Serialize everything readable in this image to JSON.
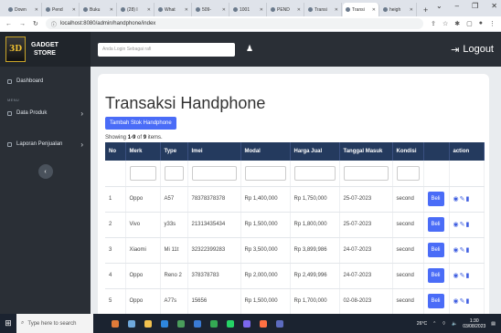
{
  "browser": {
    "tabs": [
      {
        "label": "Down",
        "active": false
      },
      {
        "label": "Pend",
        "active": false
      },
      {
        "label": "Buku",
        "active": false
      },
      {
        "label": "(28) I",
        "active": false
      },
      {
        "label": "What",
        "active": false
      },
      {
        "label": "509-",
        "active": false
      },
      {
        "label": "1001",
        "active": false
      },
      {
        "label": "PEND",
        "active": false
      },
      {
        "label": "Transi",
        "active": false
      },
      {
        "label": "Transi",
        "active": true
      },
      {
        "label": "heigh",
        "active": false
      }
    ],
    "new_tab": "+",
    "url": "localhost:8080/admin/handphone/index"
  },
  "sidebar": {
    "brand_line1": "GADGET",
    "brand_line2": "STORE",
    "logo_text": "3D",
    "items": [
      {
        "label": "Dashboard"
      },
      {
        "label": "Data Produk"
      },
      {
        "label": "Laporan Penjualan"
      }
    ],
    "heading": "MENU"
  },
  "navbar": {
    "search_placeholder": "Anda Login Sebagai rafi",
    "logout_label": "Logout"
  },
  "page": {
    "title": "Transaksi Handphone",
    "add_button": "Tambah Stok Handphone",
    "summary_prefix": "Showing ",
    "summary_range": "1-9",
    "summary_of": " of ",
    "summary_total": "9",
    "summary_suffix": " items."
  },
  "table": {
    "headers": [
      "No",
      "Merk",
      "Type",
      "Imei",
      "Modal",
      "Harga Jual",
      "Tanggal Masuk",
      "Kondisi",
      "",
      "action"
    ],
    "rows": [
      [
        "1",
        "Oppo",
        "A57",
        "78378378378",
        "Rp 1,400,000",
        "Rp 1,750,000",
        "25-07-2023",
        "second"
      ],
      [
        "2",
        "Vivo",
        "y33s",
        "21313435434",
        "Rp 1,500,000",
        "Rp 1,800,000",
        "25-07-2023",
        "second"
      ],
      [
        "3",
        "Xiaomi",
        "Mi 11t",
        "32322399283",
        "Rp 3,500,000",
        "Rp 3,899,986",
        "24-07-2023",
        "second"
      ],
      [
        "4",
        "Oppo",
        "Reno 2",
        "378378783",
        "Rp 2,000,000",
        "Rp 2,499,996",
        "24-07-2023",
        "second"
      ],
      [
        "5",
        "Oppo",
        "A77s",
        "15656",
        "Rp 1,500,000",
        "Rp 1,700,000",
        "02-08-2023",
        "second"
      ]
    ],
    "beli_label": "Beli",
    "action_icons": [
      "eye-icon",
      "pencil-icon",
      "trash-icon"
    ]
  },
  "taskbar": {
    "search_placeholder": "Type here to search",
    "weather": "26°C",
    "time": "1:30",
    "date": "03/08/2023"
  }
}
